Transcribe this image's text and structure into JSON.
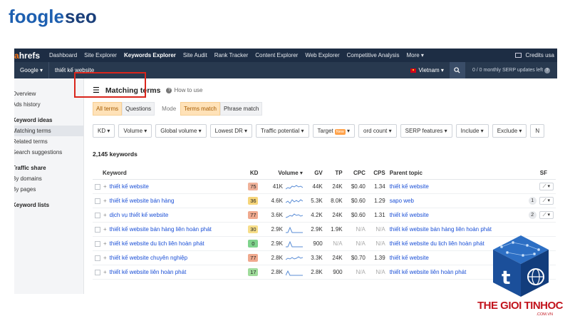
{
  "watermark_top": {
    "brand_a": "foogle",
    "brand_b": "seo"
  },
  "topbar": {
    "logo_a": "a",
    "logo_b": "hrefs",
    "nav": [
      "Dashboard",
      "Site Explorer",
      "Keywords Explorer",
      "Site Audit",
      "Rank Tracker",
      "Content Explorer",
      "Web Explorer",
      "Competitive Analysis",
      "More ▾"
    ],
    "active_nav": "Keywords Explorer",
    "credits": "Credits usa"
  },
  "searchbar": {
    "engine": "Google ▾",
    "query": "thiết kế website",
    "country": "Vietnam ▾",
    "serp_info": "0 / 0 monthly SERP updates left"
  },
  "sidebar": {
    "items": [
      {
        "type": "item",
        "label": "Overview"
      },
      {
        "type": "item",
        "label": "Ads history"
      },
      {
        "type": "heading",
        "label": "Keyword ideas"
      },
      {
        "type": "item",
        "label": "Matching terms",
        "selected": true
      },
      {
        "type": "item",
        "label": "Related terms"
      },
      {
        "type": "item",
        "label": "Search suggestions"
      },
      {
        "type": "heading",
        "label": "Traffic share"
      },
      {
        "type": "item",
        "label": "By domains"
      },
      {
        "type": "item",
        "label": "By pages"
      },
      {
        "type": "heading",
        "label": "Keyword lists"
      }
    ]
  },
  "main": {
    "title": "Matching terms",
    "how_to": "How to use",
    "tabs": [
      {
        "label": "All terms",
        "selected": true
      },
      {
        "label": "Questions",
        "selected": false
      }
    ],
    "mode_label": "Mode",
    "mode_tabs": [
      {
        "label": "Terms match",
        "selected": true
      },
      {
        "label": "Phrase match",
        "selected": false
      }
    ],
    "filters": [
      "KD ▾",
      "Volume ▾",
      "Global volume ▾",
      "Lowest DR ▾",
      "Traffic potential ▾",
      "Target",
      "ord count ▾",
      "SERP features ▾",
      "Include ▾",
      "Exclude ▾",
      "N"
    ],
    "new_badge": "New",
    "keyword_count": "2,145 keywords"
  },
  "table": {
    "headers": [
      "Keyword",
      "KD",
      "Volume ▾",
      "GV",
      "TP",
      "CPC",
      "CPS",
      "Parent topic",
      "SF"
    ],
    "rows": [
      {
        "keyword": "thiết kế website",
        "kd": "75",
        "kd_color": "#f0b29a",
        "volume": "41K",
        "gv": "44K",
        "tp": "24K",
        "cpc": "$0.40",
        "cps": "1.34",
        "parent": "thiết kế website",
        "sf": "",
        "pill": true
      },
      {
        "keyword": "thiết kế website bán hàng",
        "kd": "36",
        "kd_color": "#f6d57a",
        "volume": "4.6K",
        "gv": "5.3K",
        "tp": "8.0K",
        "cpc": "$0.60",
        "cps": "1.29",
        "parent": "sapo web",
        "sf": "1",
        "pill": true
      },
      {
        "keyword": "dịch vụ thiết kế website",
        "kd": "77",
        "kd_color": "#f0a98e",
        "volume": "3.6K",
        "gv": "4.2K",
        "tp": "24K",
        "cpc": "$0.60",
        "cps": "1.31",
        "parent": "thiết kế website",
        "sf": "2",
        "pill": true
      },
      {
        "keyword": "thiết kế website bán hàng liên hoàn phát",
        "kd": "30",
        "kd_color": "#f7de8a",
        "volume": "2.9K",
        "gv": "2.9K",
        "tp": "1.9K",
        "cpc": "N/A",
        "cps": "N/A",
        "parent": "thiết kế website bán hàng liên hoàn phát",
        "sf": "",
        "pill": false
      },
      {
        "keyword": "thiết kế website du lịch liên hoàn phát",
        "kd": "0",
        "kd_color": "#7fd38c",
        "volume": "2.9K",
        "gv": "900",
        "tp": "N/A",
        "cpc": "N/A",
        "cps": "N/A",
        "parent": "thiết kế website du lịch liên hoàn phát",
        "sf": "",
        "pill": false
      },
      {
        "keyword": "thiết kế website chuyên nghiệp",
        "kd": "77",
        "kd_color": "#f0a98e",
        "volume": "2.8K",
        "gv": "3.3K",
        "tp": "24K",
        "cpc": "$0.70",
        "cps": "1.39",
        "parent": "thiết kế website",
        "sf": "",
        "pill": false
      },
      {
        "keyword": "thiết kế website liên hoàn phát",
        "kd": "17",
        "kd_color": "#9fdc9b",
        "volume": "2.8K",
        "gv": "2.8K",
        "tp": "900",
        "cpc": "N/A",
        "cps": "N/A",
        "parent": "thiết kế website liên hoàn phát",
        "sf": "",
        "pill": false
      }
    ]
  },
  "watermark_bottom": {
    "text": "THE GIOI TINHOC",
    "sub": ".COM.VN",
    "cube_letter": "t"
  },
  "colors": {
    "topbar": "#1d2d44",
    "searchbar": "#28394f",
    "link": "#1a4fd6",
    "highlight": "#d9261c",
    "brand": "#1d5fb0",
    "watermark_red": "#c2141d"
  }
}
